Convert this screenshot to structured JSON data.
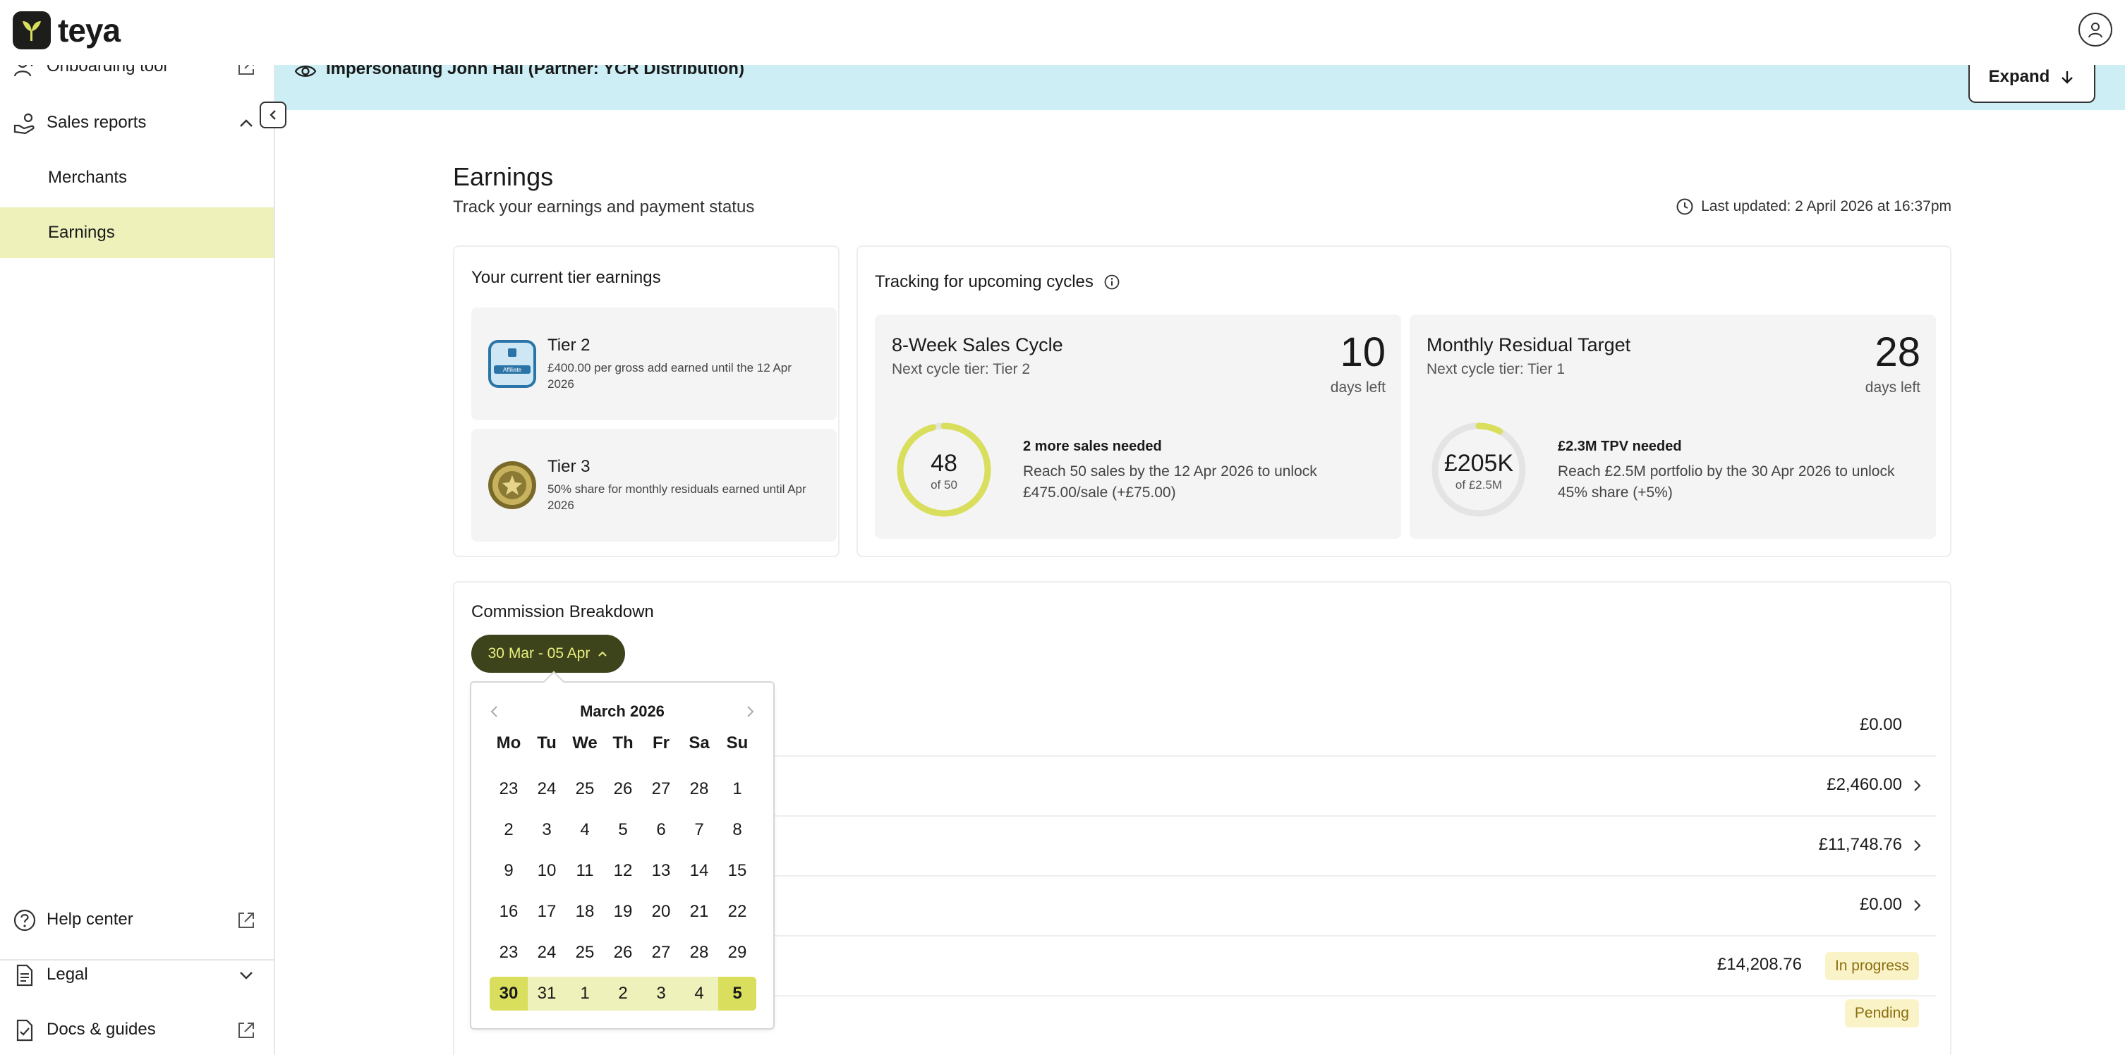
{
  "app": {
    "brand": "teya"
  },
  "sidebar": {
    "items": [
      {
        "label": "Onboarding tool",
        "icon": "user-plus-icon",
        "right_icon": "external-link-icon"
      },
      {
        "label": "Sales reports",
        "icon": "hand-coins-icon",
        "right_icon": "chevron-up-icon"
      }
    ],
    "sub_items": [
      {
        "label": "Merchants",
        "active": false
      },
      {
        "label": "Earnings",
        "active": true
      }
    ],
    "bottom_items": [
      {
        "label": "Help center",
        "icon": "help-circle-icon",
        "right_icon": "external-link-icon"
      },
      {
        "label": "Legal",
        "icon": "document-icon",
        "right_icon": "chevron-down-icon"
      },
      {
        "label": "Docs & guides",
        "icon": "document-check-icon",
        "right_icon": "external-link-icon"
      }
    ]
  },
  "banner": {
    "text": "Impersonating John Hall (Partner: YCR Distribution)",
    "expand_label": "Expand"
  },
  "page": {
    "title": "Earnings",
    "subtitle": "Track your earnings and payment status",
    "last_updated": "Last updated: 2 April 2026 at 16:37pm"
  },
  "tier_card": {
    "title": "Your current tier earnings",
    "tiers": [
      {
        "name": "Tier 2",
        "description": "£400.00 per gross add earned until the 12 Apr 2026",
        "badge_text": "Affiliate"
      },
      {
        "name": "Tier 3",
        "description": "50% share for monthly residuals earned until Apr 2026"
      }
    ]
  },
  "tracking_card": {
    "title": "Tracking for upcoming cycles",
    "cycles": [
      {
        "name": "8-Week Sales Cycle",
        "next_tier": "Next cycle tier: Tier 2",
        "days": "10",
        "days_label": "days left",
        "ring_value": "48",
        "ring_of": "of 50",
        "progress": 0.96,
        "need_title": "2 more sales needed",
        "need_desc": "Reach 50 sales by the 12 Apr 2026 to unlock £475.00/sale (+£75.00)"
      },
      {
        "name": "Monthly Residual Target",
        "next_tier": "Next cycle tier: Tier 1",
        "days": "28",
        "days_label": "days left",
        "ring_value": "£205K",
        "ring_of": "of £2.5M",
        "progress": 0.08,
        "need_title": "£2.3M TPV needed",
        "need_desc": "Reach £2.5M portfolio by the 30 Apr 2026 to unlock 45% share (+5%)"
      }
    ]
  },
  "commission": {
    "title": "Commission Breakdown",
    "range_label": "30 Mar - 05 Apr",
    "rows": [
      {
        "amount": "£0.00",
        "chevron": false,
        "badge": ""
      },
      {
        "amount": "£2,460.00",
        "chevron": true,
        "badge": ""
      },
      {
        "amount": "£11,748.76",
        "chevron": true,
        "badge": ""
      },
      {
        "amount": "£0.00",
        "chevron": true,
        "badge": ""
      },
      {
        "amount": "£14,208.76",
        "chevron": false,
        "badge": "In progress"
      },
      {
        "amount": "",
        "chevron": false,
        "badge": "Pending"
      }
    ]
  },
  "calendar": {
    "month": "March 2026",
    "weekdays": [
      "Mo",
      "Tu",
      "We",
      "Th",
      "Fr",
      "Sa",
      "Su"
    ],
    "weeks": [
      [
        "23",
        "24",
        "25",
        "26",
        "27",
        "28",
        "1"
      ],
      [
        "2",
        "3",
        "4",
        "5",
        "6",
        "7",
        "8"
      ],
      [
        "9",
        "10",
        "11",
        "12",
        "13",
        "14",
        "15"
      ],
      [
        "16",
        "17",
        "18",
        "19",
        "20",
        "21",
        "22"
      ],
      [
        "23",
        "24",
        "25",
        "26",
        "27",
        "28",
        "29"
      ],
      [
        "30",
        "31",
        "1",
        "2",
        "3",
        "4",
        "5"
      ]
    ],
    "selected_week_index": 5
  },
  "colors": {
    "accent_dark": "#3d431b",
    "accent_light": "#eef1b9",
    "accent": "#d9df5d",
    "banner": "#cdeef4",
    "ring": "#d9df5d"
  }
}
